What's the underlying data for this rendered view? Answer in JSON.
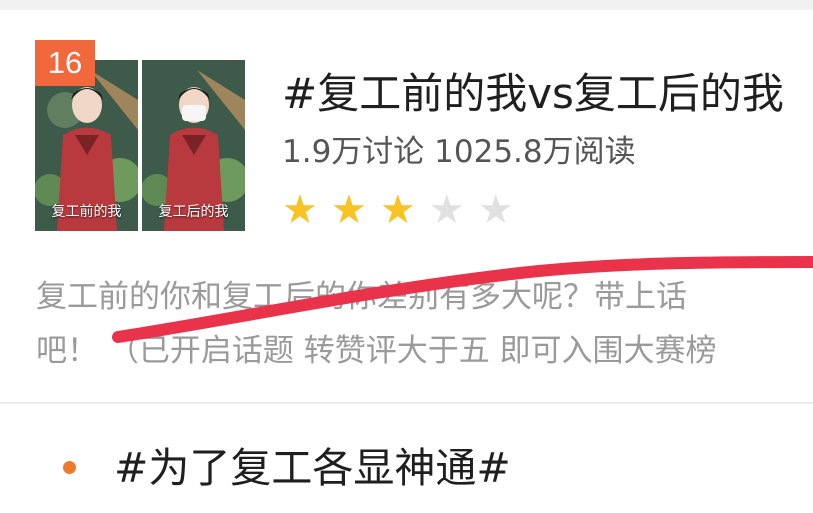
{
  "topic": {
    "rank": "16",
    "title": "#复工前的我vs复工后的我",
    "stats": "1.9万讨论 1025.8万阅读",
    "stars_filled": 3,
    "stars_total": 5,
    "thumbnail_left_caption": "复工前的我",
    "thumbnail_right_caption": "复工后的我",
    "description_line1": "复工前的你和复工后的你差别有多大呢？带上话",
    "description_line2": "吧！ （已开启话题 转赞评大于五 即可入围大赛榜"
  },
  "next_topic": {
    "title": "#为了复工各显神通#"
  },
  "colors": {
    "badge": "#f0683b",
    "star_on": "#f7c325",
    "star_off": "#e1e1e1",
    "bullet": "#f07a2c",
    "scribble": "#e8334a"
  },
  "icons": {
    "star": "star-icon",
    "bullet": "bullet-dot-icon"
  }
}
